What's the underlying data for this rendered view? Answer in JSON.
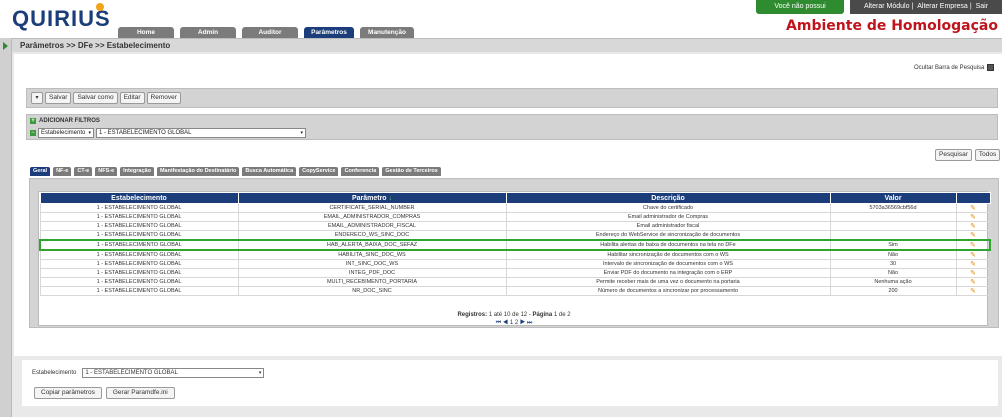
{
  "header": {
    "logo": "QUIRIUS",
    "notification": "Você não possui notificações",
    "links": [
      "Alterar Módulo",
      "Alterar Empresa",
      "Sair"
    ],
    "environment": "Ambiente de Homologação",
    "tabs": [
      {
        "label": "Home",
        "active": false
      },
      {
        "label": "Admin",
        "active": false
      },
      {
        "label": "Auditor",
        "active": false
      },
      {
        "label": "Parâmetros",
        "active": true
      },
      {
        "label": "Manutenção",
        "active": false
      }
    ]
  },
  "breadcrumb": "Parâmetros >> DFe >> Estabelecimento",
  "search": {
    "hide_label": "Ocultar Barra de Pesquisa"
  },
  "toolbar": {
    "save": "Salvar",
    "save_as": "Salvar como",
    "edit": "Editar",
    "remove": "Remover"
  },
  "filters": {
    "add_label": "ADICIONAR FILTROS",
    "field": "Estabelecimento",
    "value": "1 - ESTABELECIMENTO GLOBAL"
  },
  "actions": {
    "search": "Pesquisar",
    "all": "Todos"
  },
  "subtabs": [
    {
      "label": "Geral",
      "active": true
    },
    {
      "label": "NF-e",
      "active": false
    },
    {
      "label": "CT-e",
      "active": false
    },
    {
      "label": "NFS-e",
      "active": false
    },
    {
      "label": "Integração",
      "active": false
    },
    {
      "label": "Manifestação do Destinatário",
      "active": false
    },
    {
      "label": "Busca Automática",
      "active": false
    },
    {
      "label": "CopyService",
      "active": false
    },
    {
      "label": "Conferencia",
      "active": false
    },
    {
      "label": "Gestão de Terceiros",
      "active": false
    }
  ],
  "table": {
    "columns": [
      "Estabelecimento",
      "Parâmetro",
      "Descrição",
      "Valor"
    ],
    "sort_icon": "arrow-down-icon",
    "rows": [
      {
        "estab": "1 - ESTABELECIMENTO GLOBAL",
        "param": "CERTIFICATE_SERIAL_NUMBER",
        "desc": "Chave do certificado",
        "valor": "5703a36569cbf56d"
      },
      {
        "estab": "1 - ESTABELECIMENTO GLOBAL",
        "param": "EMAIL_ADMINISTRADOR_COMPRAS",
        "desc": "Email administrador de Compras",
        "valor": ""
      },
      {
        "estab": "1 - ESTABELECIMENTO GLOBAL",
        "param": "EMAIL_ADMINISTRADOR_FISCAL",
        "desc": "Email administrador fiscal",
        "valor": ""
      },
      {
        "estab": "1 - ESTABELECIMENTO GLOBAL",
        "param": "ENDERECO_WS_SINC_DOC",
        "desc": "Endereço do WebService de sincronização de documentos",
        "valor": ""
      },
      {
        "estab": "1 - ESTABELECIMENTO GLOBAL",
        "param": "HAB_ALERTA_BAIXA_DOC_SEFAZ",
        "desc": "Habilita alertas de baixa de documentos na tela no DFe",
        "valor": "Sim",
        "highlight": true
      },
      {
        "estab": "1 - ESTABELECIMENTO GLOBAL",
        "param": "HABILITA_SINC_DOC_WS",
        "desc": "Habilitar sincronização de documentos com o WS",
        "valor": "Não"
      },
      {
        "estab": "1 - ESTABELECIMENTO GLOBAL",
        "param": "INT_SINC_DOC_WS",
        "desc": "Intervalo de sincronização de documentos com o WS",
        "valor": "30"
      },
      {
        "estab": "1 - ESTABELECIMENTO GLOBAL",
        "param": "INTEG_PDF_DOC",
        "desc": "Enviar PDF do documento na integração com o ERP",
        "valor": "Não"
      },
      {
        "estab": "1 - ESTABELECIMENTO GLOBAL",
        "param": "MULTI_RECEBIMENTO_PORTARIA",
        "desc": "Permite receber mais de uma vez o documento na portaria",
        "valor": "Nenhuma ação"
      },
      {
        "estab": "1 - ESTABELECIMENTO GLOBAL",
        "param": "NR_DOC_SINC",
        "desc": "Número de documentos a sincronizar por processamento",
        "valor": "200"
      }
    ]
  },
  "pager": {
    "label": "Registros:",
    "range": "1 até 10 de 12",
    "page_label": "Página",
    "page": "1 de 2",
    "nav": "⏮ ◀ 1 2 ▶ ⏭"
  },
  "bottom": {
    "field_label": "Estabelecimento",
    "value": "1 - ESTABELECIMENTO GLOBAL",
    "copy_button": "Copiar parâmetros",
    "generate_button": "Gerar Paramdfe.ini"
  },
  "colors": {
    "brand": "#1b3d7a",
    "env_title": "#c0141c",
    "notify": "#2f8b2f",
    "highlight": "#2ea52e",
    "edit_icon": "#e88a10"
  }
}
